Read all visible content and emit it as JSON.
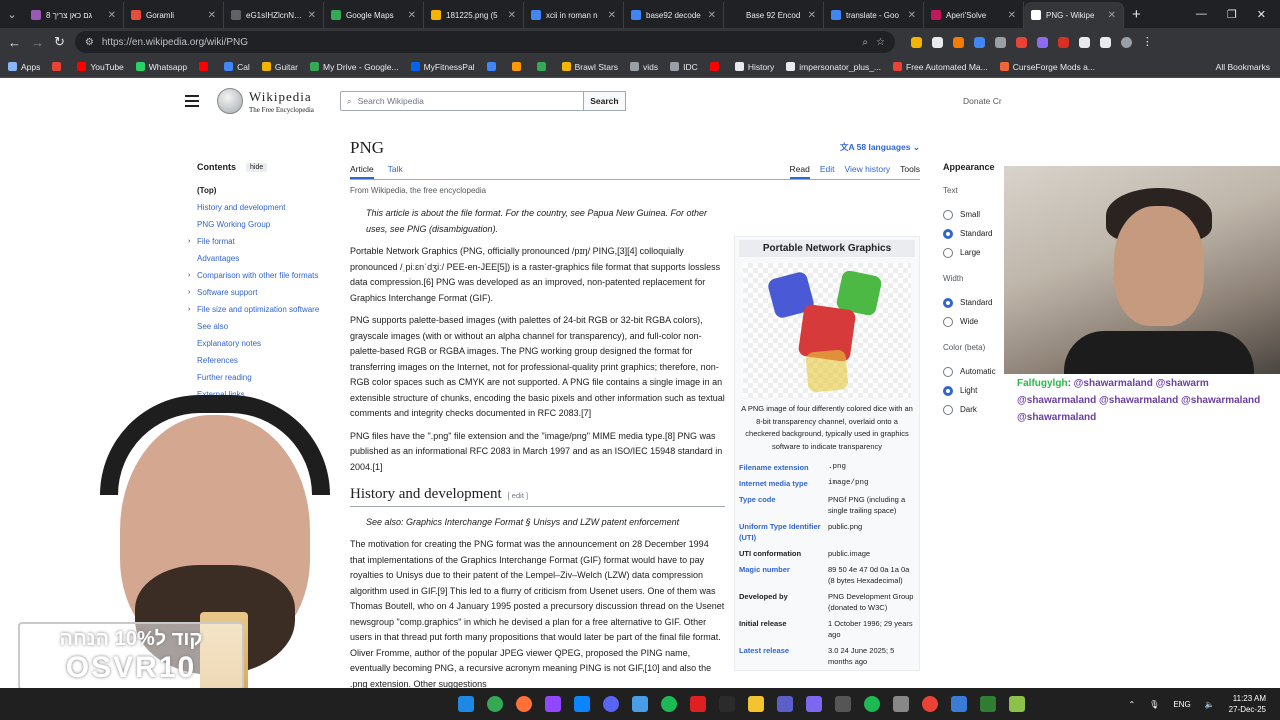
{
  "browser": {
    "tabs": [
      {
        "title": "גם כאן צריך 8",
        "color": "#9b59b6",
        "active": false
      },
      {
        "title": "Goramli",
        "color": "#e74c3c",
        "active": false
      },
      {
        "title": "eG1sIHZlcnNpb",
        "color": "#5f6368",
        "active": false
      },
      {
        "title": "Google Maps",
        "color": "#34a853",
        "active": false
      },
      {
        "title": "181225.png (5",
        "color": "#f4b400",
        "active": false
      },
      {
        "title": "xcii in roman n",
        "color": "#4285f4",
        "active": false
      },
      {
        "title": "base92 decode",
        "color": "#4285f4",
        "active": false
      },
      {
        "title": "Base 92 Encod",
        "color": "#202124",
        "active": false
      },
      {
        "title": "translate - Goo",
        "color": "#4285f4",
        "active": false
      },
      {
        "title": "Aperi'Solve",
        "color": "#c2185b",
        "active": false
      },
      {
        "title": "PNG - Wikipe",
        "color": "#ffffff",
        "active": true
      }
    ],
    "url": "https://en.wikipedia.org/wiki/PNG",
    "bookmarks": [
      {
        "label": "Apps",
        "color": "#8ab4f8"
      },
      {
        "label": "",
        "color": "#ea4335"
      },
      {
        "label": "YouTube",
        "color": "#ff0000"
      },
      {
        "label": "Whatsapp",
        "color": "#25d366"
      },
      {
        "label": "",
        "color": "#ff0000"
      },
      {
        "label": "Cal",
        "color": "#4285f4"
      },
      {
        "label": "Guitar",
        "color": "#f4b400"
      },
      {
        "label": "My Drive - Google...",
        "color": "#34a853"
      },
      {
        "label": "MyFitnessPal",
        "color": "#0066ee"
      },
      {
        "label": "",
        "color": "#4285f4"
      },
      {
        "label": "",
        "color": "#ff9900"
      },
      {
        "label": "",
        "color": "#34a853"
      },
      {
        "label": "Brawl Stars",
        "color": "#f4b400"
      },
      {
        "label": "vids",
        "color": "#9aa0a6"
      },
      {
        "label": "IDC",
        "color": "#9aa0a6"
      },
      {
        "label": "",
        "color": "#ff0000"
      },
      {
        "label": "History",
        "color": "#e8eaed"
      },
      {
        "label": "impersonator_plus_...",
        "color": "#e8eaed"
      },
      {
        "label": "Free Automated Ma...",
        "color": "#ea4335"
      },
      {
        "label": "CurseForge Mods a...",
        "color": "#f16436"
      }
    ],
    "all_bookmarks": "All Bookmarks"
  },
  "wiki": {
    "logo_title": "Wikipedia",
    "logo_sub": "The Free Encyclopedia",
    "search_placeholder": "Search Wikipedia",
    "search_button": "Search",
    "donate": "Donate Cr",
    "toc_title": "Contents",
    "toc_hide": "hide",
    "toc": [
      {
        "label": "(Top)",
        "top": true,
        "arrow": false
      },
      {
        "label": "History and development",
        "arrow": false
      },
      {
        "label": "PNG Working Group",
        "arrow": false
      },
      {
        "label": "File format",
        "arrow": true
      },
      {
        "label": "Advantages",
        "arrow": false
      },
      {
        "label": "Comparison with other file formats",
        "arrow": true
      },
      {
        "label": "Software support",
        "arrow": true
      },
      {
        "label": "File size and optimization software",
        "arrow": true
      },
      {
        "label": "See also",
        "arrow": false
      },
      {
        "label": "Explanatory notes",
        "arrow": false
      },
      {
        "label": "References",
        "arrow": false
      },
      {
        "label": "Further reading",
        "arrow": false
      },
      {
        "label": "External links",
        "arrow": false
      }
    ],
    "title": "PNG",
    "languages": "58 languages",
    "tab_article": "Article",
    "tab_talk": "Talk",
    "tab_read": "Read",
    "tab_edit": "Edit",
    "tab_history": "View history",
    "tab_tools": "Tools",
    "from": "From Wikipedia, the free encyclopedia",
    "hatnote": "This article is about the file format. For the country, see Papua New Guinea. For other uses, see PNG (disambiguation).",
    "paragraphs": [
      "Portable Network Graphics (PNG, officially pronounced /pɪŋ/ PING,[3][4] colloquially pronounced /ˌpiːɛnˈdʒiː/ PEE-en-JEE[5]) is a raster-graphics file format that supports lossless data compression.[6] PNG was developed as an improved, non-patented replacement for Graphics Interchange Format (GIF).",
      "PNG supports palette-based images (with palettes of 24-bit RGB or 32-bit RGBA colors), grayscale images (with or without an alpha channel for transparency), and full-color non-palette-based RGB or RGBA images. The PNG working group designed the format for transferring images on the Internet, not for professional-quality print graphics; therefore, non-RGB color spaces such as CMYK are not supported. A PNG file contains a single image in an extensible structure of chunks, encoding the basic pixels and other information such as textual comments and integrity checks documented in RFC 2083.[7]",
      "PNG files have the \".png\" file extension and the \"image/png\" MIME media type.[8] PNG was published as an informational RFC 2083 in March 1997 and as an ISO/IEC 15948 standard in 2004.[1]"
    ],
    "h2": "History and development",
    "h2_edit": "[ edit ]",
    "see_also": "See also: Graphics Interchange Format § Unisys and LZW patent enforcement",
    "history_para": "The motivation for creating the PNG format was the announcement on 28 December 1994 that implementations of the Graphics Interchange Format (GIF) format would have to pay royalties to Unisys due to their patent of the Lempel–Ziv–Welch (LZW) data compression algorithm used in GIF.[9] This led to a flurry of criticism from Usenet users. One of them was Thomas Boutell, who on 4 January 1995 posted a precursory discussion thread on the Usenet newsgroup \"comp.graphics\" in which he devised a plan for a free alternative to GIF. Other users in that thread put forth many propositions that would later be part of the final file format. Oliver Fromme, author of the popular JPEG viewer QPEG, proposed the PING name, eventually becoming PNG, a recursive acronym meaning PING is not GIF,[10] and also the .png extension. Other suggestions",
    "infobox": {
      "title": "Portable Network Graphics",
      "caption": "A PNG image of four differently colored dice with an 8-bit transparency channel, overlaid onto a checkered background, typically used in graphics software to indicate transparency",
      "rows": [
        {
          "k": "Filename extension",
          "v": ".png",
          "mono": true,
          "plain": false
        },
        {
          "k": "Internet media type",
          "v": "image/png",
          "mono": true,
          "plain": false
        },
        {
          "k": "Type code",
          "v": "PNGf  PNG (including a single trailing space)",
          "mono": false,
          "plain": false
        },
        {
          "k": "Uniform Type Identifier (UTI)",
          "v": "public.png",
          "mono": false,
          "plain": false
        },
        {
          "k": "UTI conformation",
          "v": "public.image",
          "mono": false,
          "plain": true
        },
        {
          "k": "Magic number",
          "v": "89 50 4e 47 0d 0a 1a 0a (8 bytes Hexadecimal)",
          "mono": false,
          "plain": false
        },
        {
          "k": "Developed by",
          "v": "PNG Development Group (donated to W3C)",
          "mono": false,
          "plain": true
        },
        {
          "k": "Initial release",
          "v": "1 October 1996; 29 years ago",
          "mono": false,
          "plain": true
        },
        {
          "k": "Latest release",
          "v": "3.0  24 June 2025; 5 months ago",
          "mono": false,
          "plain": false
        }
      ]
    },
    "appearance": {
      "title": "Appearance",
      "text_label": "Text",
      "text_options": [
        {
          "label": "Small",
          "on": false
        },
        {
          "label": "Standard",
          "on": true
        },
        {
          "label": "Large",
          "on": false
        }
      ],
      "width_label": "Width",
      "width_options": [
        {
          "label": "Standard",
          "on": true
        },
        {
          "label": "Wide",
          "on": false
        }
      ],
      "color_label": "Color (beta)",
      "color_options": [
        {
          "label": "Automatic",
          "on": false
        },
        {
          "label": "Light",
          "on": true
        },
        {
          "label": "Dark",
          "on": false
        }
      ]
    }
  },
  "overlay": {
    "chat_user": "Falfugylgh",
    "chat_text": ": @shawarmaland @shawarm @shawarmaland @shawarmaland @shawarmaland @shawarmaland",
    "promo_line1": "קוד ל10% הנחה",
    "promo_line2": "OSVR10"
  },
  "taskbar": {
    "lang": "ENG",
    "time": "11:23 AM",
    "date": "27-Dec-25"
  }
}
